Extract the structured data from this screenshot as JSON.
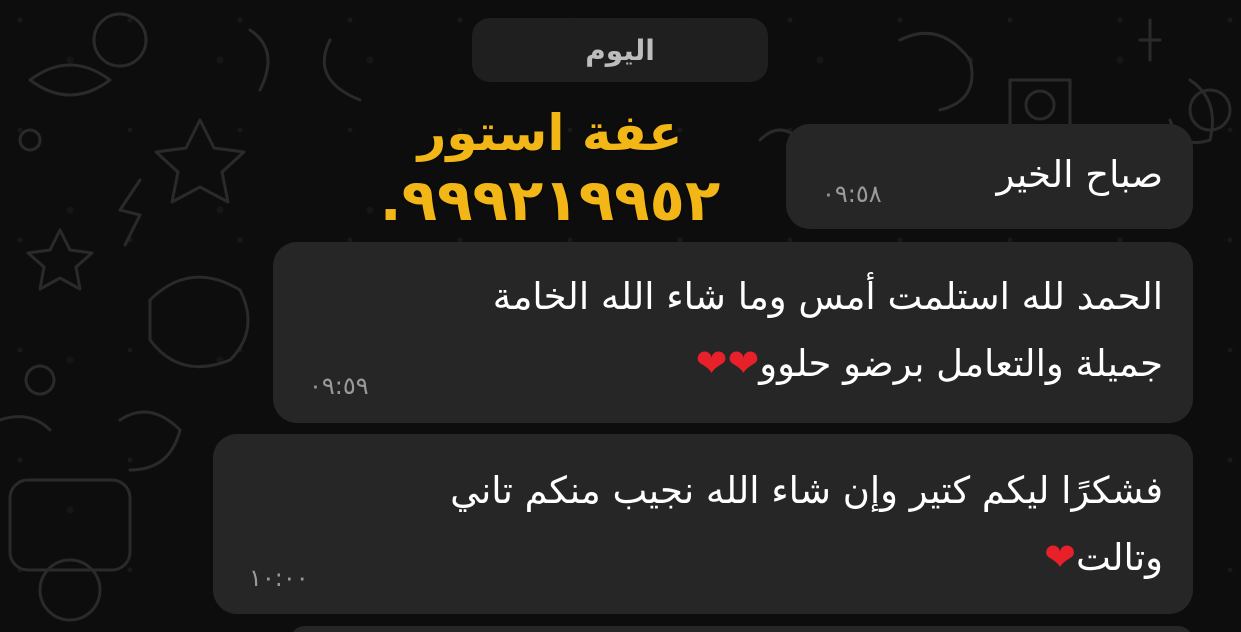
{
  "chat": {
    "date_divider": "اليوم",
    "watermark": {
      "name": "عفة استور",
      "phone": ".٩٩٩٢١٩٩٥٢"
    },
    "messages": [
      {
        "lines": [
          "صباح الخير"
        ],
        "time": "٠٩:٥٨"
      },
      {
        "lines": [
          "الحمد لله استلمت أمس وما شاء الله الخامة",
          "جميلة والتعامل برضو حلوو"
        ],
        "time": "٠٩:٥٩"
      },
      {
        "lines": [
          "فشكرًا ليكم كتير وإن شاء الله نجيب منكم تاني",
          "وتالت"
        ],
        "time": "١٠:٠٠"
      }
    ]
  },
  "colors": {
    "background": "#0b0b0b",
    "bubble": "#262626",
    "watermark": "#f2b716",
    "heart": "#e8202a"
  },
  "icons": [
    "heart-emoji",
    "doodle-wallpaper"
  ]
}
